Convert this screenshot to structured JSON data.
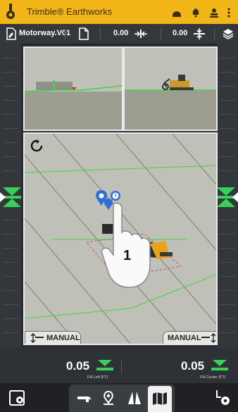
{
  "app": {
    "title": "Trimble® Earthworks",
    "brand_color": "#f2b619"
  },
  "toolbar": {
    "design_name": "Motorway.V01",
    "cross_slope_value": "0.00",
    "elevation_value": "0.00"
  },
  "main_view": {
    "touch_hint_number": "1",
    "manual_left_label": "MANUAL",
    "manual_right_label": "MANUAL",
    "design_line_color": "#3fd43f",
    "guidance_color": "#35d15a"
  },
  "guidance": {
    "left_value": "0.05",
    "left_caption": "Fill Left [FT]",
    "right_value": "0.05",
    "right_caption": "Fill Center [FT]"
  },
  "bottom_nav": {
    "icons": [
      "settings-left-icon",
      "blade-icon",
      "location-pin-icon",
      "road-icon",
      "map-book-icon",
      "settings-right-icon"
    ]
  }
}
